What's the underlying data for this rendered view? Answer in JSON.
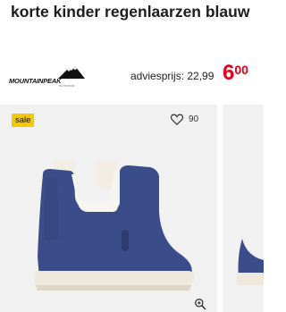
{
  "product": {
    "title": "korte kinder regenlaarzen blauw",
    "brand": "MOUNTAINPEAK",
    "brand_sub": "OUTDOOR",
    "advice_label": "adviesprijs: 22,99",
    "price_int": "6",
    "price_dec": "00"
  },
  "card": {
    "badge": "sale",
    "favorites": "90",
    "icons": {
      "favorite": "heart-outline-icon",
      "zoom": "zoom-in-icon"
    }
  },
  "colors": {
    "price": "#e2001a",
    "badge": "#f5c800",
    "boot": "#3b4c8a",
    "sole": "#efe9dd",
    "card_bg": "#f1f1f1"
  }
}
